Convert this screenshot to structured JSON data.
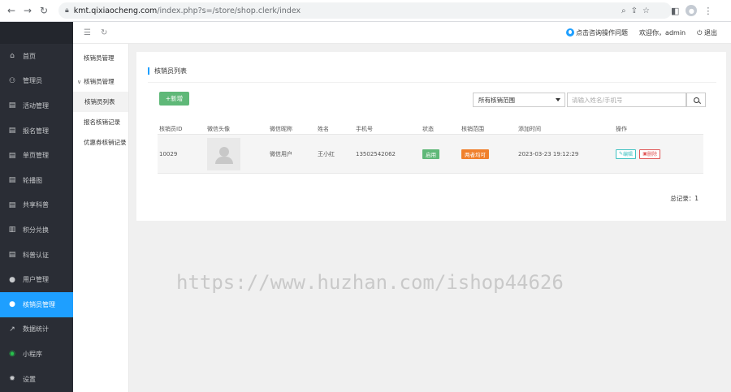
{
  "browser": {
    "url_domain": "kmt.qixiaocheng.com",
    "url_path": "/index.php?s=/store/shop.clerk/index"
  },
  "sidebar": {
    "items": [
      {
        "label": "首页",
        "icon": "home-icon",
        "glyph": "⌂"
      },
      {
        "label": "管理员",
        "icon": "admin-icon",
        "glyph": "⚇"
      },
      {
        "label": "活动管理",
        "icon": "document-icon",
        "glyph": "▤"
      },
      {
        "label": "报名管理",
        "icon": "clipboard-icon",
        "glyph": "▤"
      },
      {
        "label": "单页管理",
        "icon": "page-icon",
        "glyph": "▤"
      },
      {
        "label": "轮播图",
        "icon": "clipboard-icon",
        "glyph": "▤"
      },
      {
        "label": "共享科普",
        "icon": "document-icon",
        "glyph": "▤"
      },
      {
        "label": "积分兑换",
        "icon": "library-icon",
        "glyph": "▥"
      },
      {
        "label": "科普认证",
        "icon": "certificate-icon",
        "glyph": "▤"
      },
      {
        "label": "用户管理",
        "icon": "user-icon",
        "glyph": "●"
      },
      {
        "label": "核销员管理",
        "icon": "user-icon",
        "glyph": "●"
      },
      {
        "label": "数据统计",
        "icon": "chart-icon",
        "glyph": "↗"
      },
      {
        "label": "小程序",
        "icon": "miniprogram-icon",
        "glyph": "◉"
      },
      {
        "label": "设置",
        "icon": "gear-icon",
        "glyph": "✹"
      }
    ]
  },
  "topbar": {
    "help_link": "点击咨询操作问题",
    "welcome": "欢迎你，admin",
    "logout": "退出"
  },
  "submenu": {
    "title": "核销员管理",
    "group": "核销员管理",
    "child": "核销员列表",
    "item2": "报名核销记录",
    "item3": "优惠券核销记录"
  },
  "panel": {
    "title": "核销员列表",
    "add_button": "新增",
    "filter_select": "所有核销范围",
    "search_placeholder": "请输入姓名/手机号",
    "total": "总记录：1"
  },
  "table": {
    "headers": [
      "核销员ID",
      "微信头像",
      "微信昵称",
      "姓名",
      "手机号",
      "状态",
      "核销范围",
      "添加时间",
      "操作"
    ],
    "rows": [
      {
        "id": "10029",
        "nickname": "微信用户",
        "name": "王小红",
        "phone": "13502542062",
        "status": "启用",
        "range": "两者均可",
        "time": "2023-03-23 19:12:29",
        "edit": "编辑",
        "delete": "删除"
      }
    ]
  },
  "watermark": "https://www.huzhan.com/ishop44626",
  "colors": {
    "sidebar_bg": "#2a2d35",
    "active_blue": "#1e9fff",
    "add_green": "#5fb878",
    "range_orange": "#f0802c"
  }
}
